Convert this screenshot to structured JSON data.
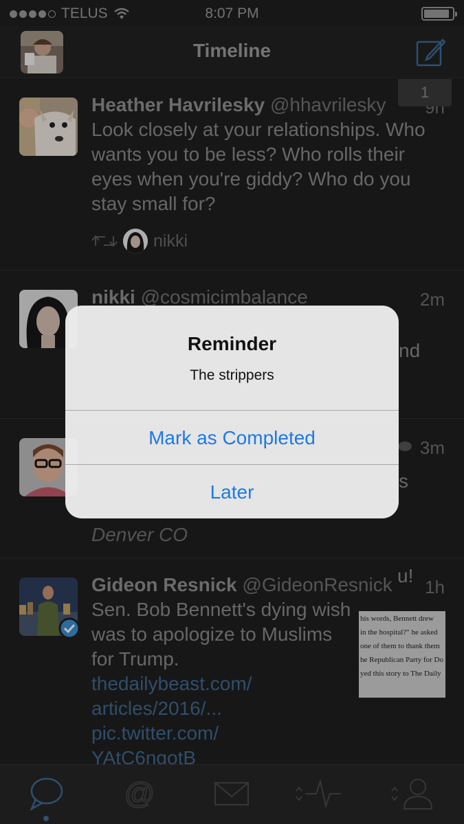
{
  "status_bar": {
    "carrier": "TELUS",
    "time": "8:07 PM",
    "signal_icon": "signal-dots-icon",
    "wifi_icon": "wifi-icon",
    "battery_icon": "battery-icon"
  },
  "navbar": {
    "title": "Timeline",
    "avatar_icon": "user-avatar",
    "compose_icon": "compose-icon"
  },
  "unread_badge": "1",
  "tweets": [
    {
      "name": "Heather Havrilesky",
      "handle": "@hhavrilesky",
      "age": "9h",
      "text": "Look closely at your relationships. Who wants you to be less? Who rolls their eyes when you're giddy? Who do you stay small for?",
      "retweeted_by": "nikki"
    },
    {
      "name": "nikki",
      "handle": "@cosmicimbalance",
      "age": "2m",
      "text_fragment": "nd"
    },
    {
      "age": "3m",
      "text_fragment_1": "s",
      "text_fragment_2": "u!",
      "location": "Denver CO"
    },
    {
      "name": "Gideon Resnick",
      "handle": "@GideonResnick",
      "age": "1h",
      "text": "Sen. Bob Bennett's dying wish was to apologize to Muslims for Trump.",
      "link_1": "thedailybeast.com/",
      "link_2": "articles/2016/...",
      "link_3": "pic.twitter.com/",
      "link_4": "YAtC6ngotB",
      "thumbnail_lines": [
        "his words, Bennett drew",
        "in the hospital?\" he asked",
        "one of them to thank them",
        "he Republican Party for Do",
        "yed this story to The Daily"
      ]
    }
  ],
  "alert": {
    "title": "Reminder",
    "message": "The strippers",
    "primary_button": "Mark as Completed",
    "secondary_button": "Later"
  },
  "tabbar": {
    "tabs": [
      "timeline-tab",
      "mentions-tab",
      "messages-tab",
      "activity-tab",
      "profile-tab"
    ],
    "active": "timeline-tab",
    "accent_color": "#3c6b96"
  }
}
